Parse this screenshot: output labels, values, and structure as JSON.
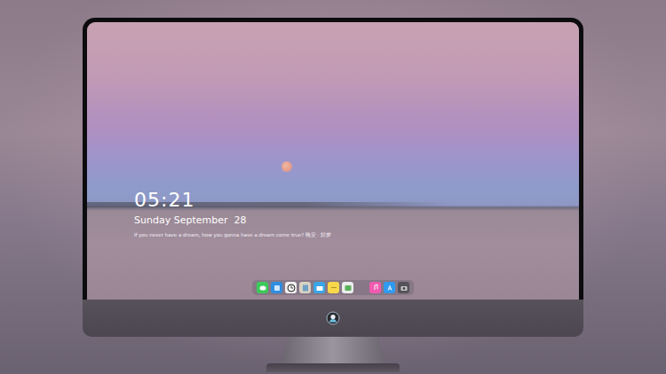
{
  "monitor": {
    "screen": {
      "lock_screen": {
        "time": "05:21",
        "date": "Sunday September  28",
        "caption": "If you never have a dream, how you gonna have a dream come true? 晚安 · 好梦"
      },
      "dock": {
        "item_count": 10,
        "separator_after": 7
      }
    }
  }
}
